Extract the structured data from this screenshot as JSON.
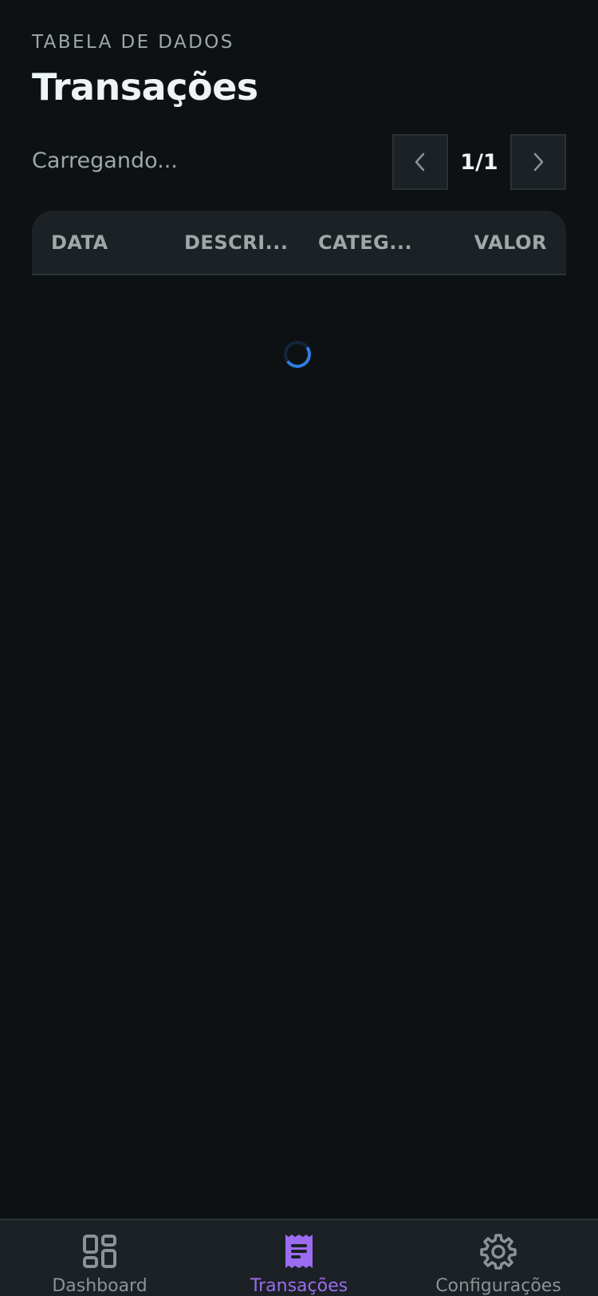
{
  "header": {
    "overline": "TABELA DE DADOS",
    "title": "Transações"
  },
  "status_text": "Carregando...",
  "pagination": {
    "label": "1/1",
    "prev_icon": "chevron-left-icon",
    "next_icon": "chevron-right-icon"
  },
  "table": {
    "columns": [
      "DATA",
      "DESCRI...",
      "CATEG...",
      "VALOR"
    ],
    "rows": []
  },
  "loading_spinner": {
    "accent_color": "#2f7de0"
  },
  "bottom_nav": {
    "items": [
      {
        "label": "Dashboard",
        "icon": "grid-icon",
        "active": false
      },
      {
        "label": "Transações",
        "icon": "receipt-icon",
        "active": true
      },
      {
        "label": "Configurações",
        "icon": "gear-icon",
        "active": false
      }
    ],
    "active_color": "#9c6cf0",
    "inactive_color": "#8a9496"
  }
}
